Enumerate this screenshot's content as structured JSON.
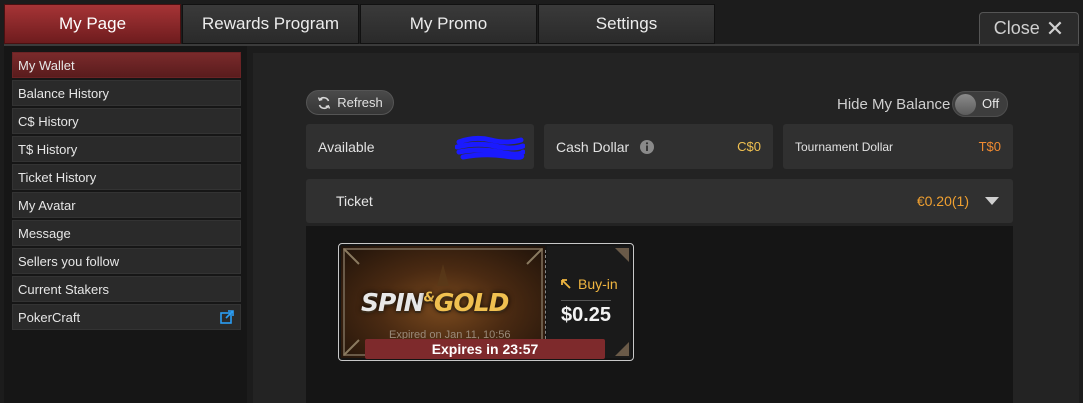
{
  "tabs": [
    {
      "label": "My Page",
      "active": true
    },
    {
      "label": "Rewards Program",
      "active": false
    },
    {
      "label": "My Promo",
      "active": false
    },
    {
      "label": "Settings",
      "active": false
    }
  ],
  "close_label": "Close",
  "sidebar": {
    "items": [
      {
        "label": "My Wallet",
        "active": true
      },
      {
        "label": "Balance History"
      },
      {
        "label": "C$ History"
      },
      {
        "label": "T$ History"
      },
      {
        "label": "Ticket History"
      },
      {
        "label": "My Avatar"
      },
      {
        "label": "Message"
      },
      {
        "label": "Sellers you follow"
      },
      {
        "label": "Current Stakers"
      },
      {
        "label": "PokerCraft",
        "icon": "external-link-icon"
      }
    ]
  },
  "wallet": {
    "refresh_label": "Refresh",
    "hide_balance_label": "Hide My Balance",
    "toggle_state": "Off",
    "available_label": "Available",
    "cash_dollar_label": "Cash Dollar",
    "cash_dollar_value": "C$0",
    "tournament_dollar_label": "Tournament Dollar",
    "tournament_dollar_value": "T$0",
    "ticket_label": "Ticket",
    "ticket_value": "€0.20(1)"
  },
  "ticket_card": {
    "logo_text_1": "SPIN",
    "logo_amp": "&",
    "logo_text_2": "GOLD",
    "expired_text": "Expired on Jan 11, 10:56",
    "expires_in": "Expires in 23:57",
    "buyin_label": "Buy-in",
    "buyin_value": "$0.25"
  },
  "colors": {
    "accent_red": "#a63436",
    "gold": "#f0c050",
    "orange": "#f0a030",
    "redaction_blue": "#1a1aff"
  }
}
